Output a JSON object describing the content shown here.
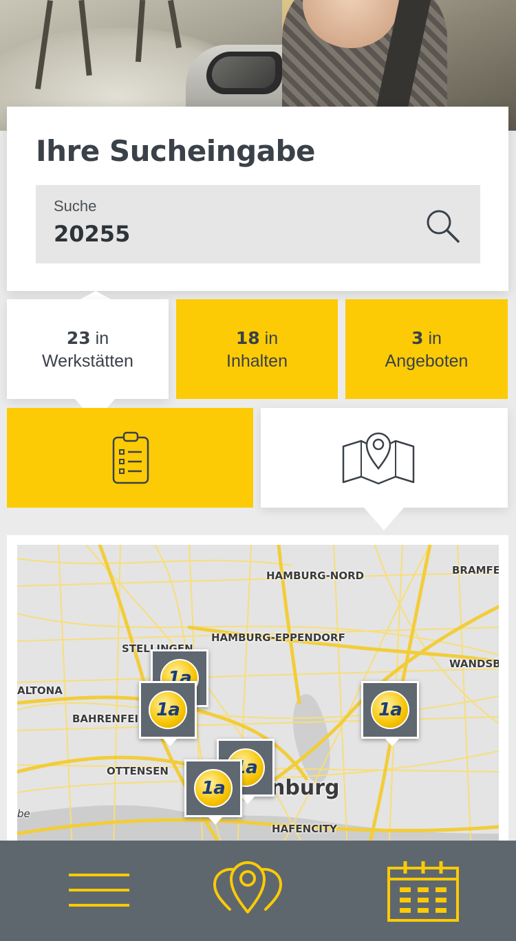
{
  "search": {
    "title": "Ihre Sucheingabe",
    "label": "Suche",
    "value": "20255"
  },
  "results": [
    {
      "count": "23",
      "suffix": " in",
      "label": "Werkstätten",
      "active": true
    },
    {
      "count": "18",
      "suffix": " in",
      "label": "Inhalten",
      "active": false
    },
    {
      "count": "3",
      "suffix": " in",
      "label": "Angeboten",
      "active": false
    }
  ],
  "views": {
    "list_icon": "clipboard-list-icon",
    "map_icon": "map-pin-icon",
    "selected": "map"
  },
  "map": {
    "labels": {
      "hamburg_nord": "HAMBURG-NORD",
      "bramfeld": "BRAMFE",
      "hamburg_eppendorf": "HAMBURG-EPPENDORF",
      "stellingen": "STELLINGEN",
      "wandsbek": "WANDSB",
      "altona": "ALTONA",
      "bahrenfeld": "BAHRENFEI",
      "ottensen": "OTTENSEN",
      "hamburg": "nburg",
      "hafencity": "HAFENCITY",
      "elbe": "be"
    },
    "marker_text": "1a"
  },
  "bottom_nav": {
    "items": [
      "menu-icon",
      "locations-icon",
      "calendar-icon"
    ]
  },
  "colors": {
    "accent": "#fccb05",
    "dark": "#3a4149",
    "nav": "#5f676e"
  }
}
